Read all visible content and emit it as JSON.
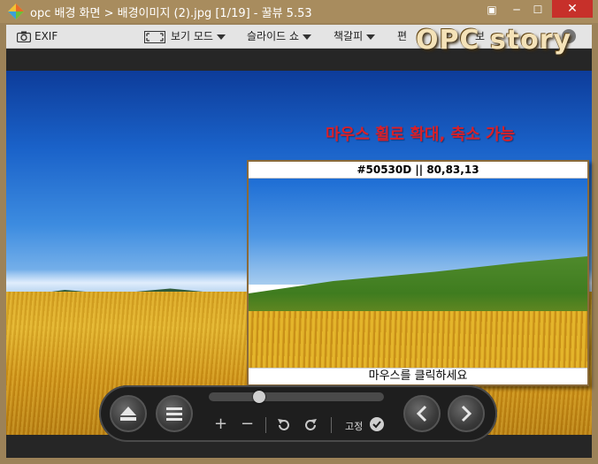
{
  "window": {
    "title": "opc 배경 화면 > 배경이미지 (2).jpg [1/19] - 꿀뷰 5.53",
    "close_label": "✕",
    "minimize_label": "─",
    "maximize_label": "☐",
    "restore_label": "▣"
  },
  "toolbar": {
    "exif_label": "EXIF",
    "view_mode_label": "보기 모드",
    "slideshow_label": "슬라이드 쇼",
    "bookmark_label": "책갈피",
    "edit_label_partial": "편",
    "print_partial": "보",
    "watermark": "OPC story"
  },
  "overlay": {
    "hint_text": "마우스 휠로 확대, 축소 가능"
  },
  "magnifier": {
    "header": "#50530D || 80,83,13",
    "footer": "마우스를 클릭하세요"
  },
  "controls": {
    "fix_label": "고정",
    "zoom_in": "+",
    "zoom_out": "−",
    "slider_value": 0.27
  },
  "colors": {
    "frame": "#a88c5e",
    "close": "#c7302a",
    "hint": "#d8202a"
  }
}
